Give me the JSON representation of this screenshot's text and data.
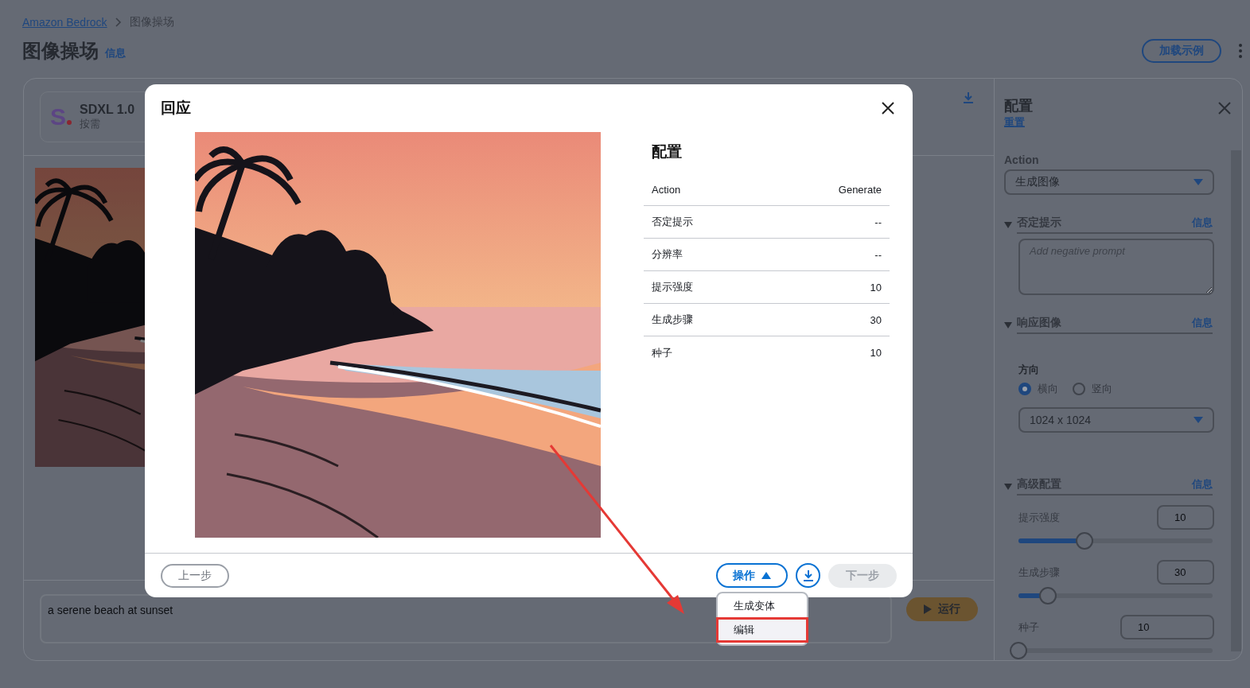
{
  "breadcrumb": [
    {
      "label": "Amazon Bedrock"
    },
    {
      "label": "图像操场"
    }
  ],
  "page": {
    "title": "图像操场",
    "info": "信息",
    "load_examples": "加载示例"
  },
  "model": {
    "logo": "S",
    "name": "SDXL 1.0",
    "mode": "按需"
  },
  "prompt": {
    "value": "a serene beach at sunset"
  },
  "run_button": "运行",
  "config_panel": {
    "title": "配置",
    "reset": "重置",
    "action_label": "Action",
    "action_value": "生成图像",
    "negative_prompt": {
      "title": "否定提示",
      "info": "信息",
      "expanded": true,
      "placeholder": "Add negative prompt"
    },
    "response_image": {
      "title": "响应图像",
      "info": "信息",
      "expanded": true,
      "orientation_label": "方向",
      "orientations": [
        {
          "label": "横向",
          "selected": true
        },
        {
          "label": "竖向",
          "selected": false
        }
      ],
      "size": "1024 x 1024"
    },
    "advanced": {
      "title": "高级配置",
      "info": "信息",
      "expanded": true,
      "sliders": [
        {
          "label": "提示强度",
          "value": "10",
          "level": 0.34
        },
        {
          "label": "生成步骤",
          "value": "30",
          "level": 0.15
        },
        {
          "label": "种子",
          "value": "10",
          "level": 0
        }
      ]
    }
  },
  "modal": {
    "title": "回应",
    "config_title": "配置",
    "rows": [
      {
        "name": "Action",
        "value": "Generate"
      },
      {
        "name": "否定提示",
        "value": "--"
      },
      {
        "name": "分辨率",
        "value": "--"
      },
      {
        "name": "提示强度",
        "value": "10"
      },
      {
        "name": "生成步骤",
        "value": "30"
      },
      {
        "name": "种子",
        "value": "10"
      }
    ],
    "prev": "上一步",
    "actions": "操作",
    "next": "下一步",
    "next_disabled": true,
    "menu_open": true,
    "menu": [
      {
        "label": "生成变体",
        "highlighted": false
      },
      {
        "label": "编辑",
        "highlighted": true
      }
    ]
  }
}
